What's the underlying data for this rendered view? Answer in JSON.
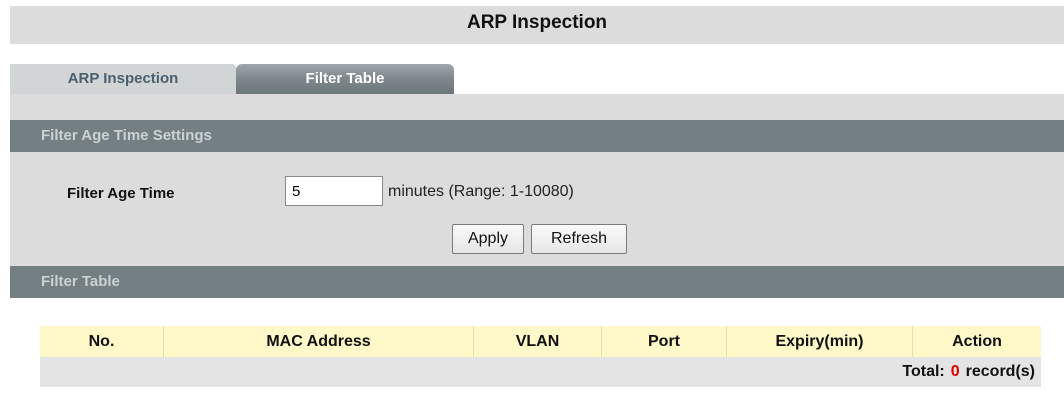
{
  "page": {
    "title": "ARP Inspection"
  },
  "tabs": [
    {
      "label": "ARP Inspection",
      "active": false
    },
    {
      "label": "Filter Table",
      "active": true
    }
  ],
  "age_settings": {
    "section_title": "Filter Age Time Settings",
    "label": "Filter Age Time",
    "value": "5",
    "range_text": "minutes (Range: 1-10080)",
    "apply_label": "Apply",
    "refresh_label": "Refresh"
  },
  "filter_table": {
    "section_title": "Filter Table",
    "columns": [
      "No.",
      "MAC Address",
      "VLAN",
      "Port",
      "Expiry(min)",
      "Action"
    ],
    "rows": [],
    "total_label": "Total:",
    "total_count": "0",
    "total_unit": "record(s)"
  },
  "colors": {
    "header_row_bg": "#fff8c8",
    "section_bar_bg": "#737f82",
    "total_count": "#e00000"
  }
}
